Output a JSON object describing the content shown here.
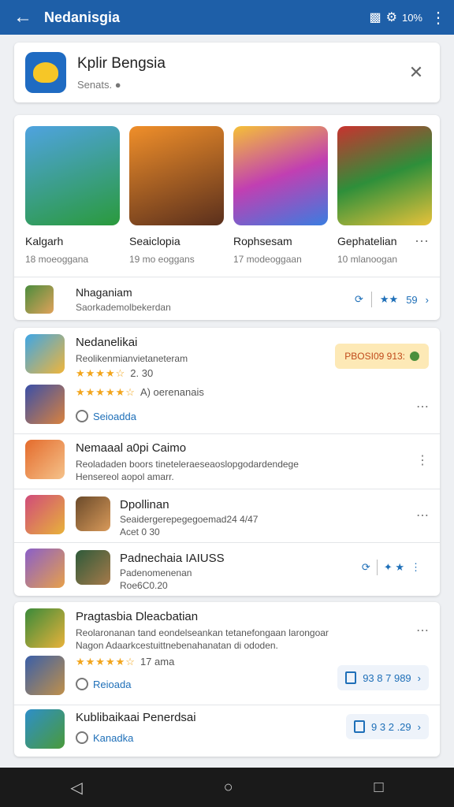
{
  "appbar": {
    "title": "Nedanisgia",
    "action_icons": [
      "image-icon",
      "settings-icon"
    ],
    "action_text": "10%",
    "more_icon": "more-vert-icon"
  },
  "header_card": {
    "app_name": "Kplir Bengsia",
    "subtitle": "Senats.",
    "close_icon": "close-icon"
  },
  "featured": {
    "tiles": [
      {
        "title": "Kalgarh",
        "meta": "18 moeoggana"
      },
      {
        "title": "Seaiclopia",
        "meta": "19 mo eoggans"
      },
      {
        "title": "Rophsesam",
        "meta": "17 modeoggaan"
      },
      {
        "title": "Gephatelian",
        "meta": "10 mlanoogan"
      }
    ],
    "promo": {
      "name": "Nhaganiam",
      "desc": "Saorkademolbekerdan",
      "rating": "59"
    }
  },
  "list1": {
    "items": [
      {
        "name": "Nedanelikai",
        "desc": "Reolikenmianvietaneteram",
        "rating_num": "2. 30",
        "badge": "PBOSI09 913:"
      },
      {
        "rating_label": "A) oerenanais",
        "link": "Seioadda"
      },
      {
        "name": "Nemaaal a0pi Caimo",
        "desc": "Reoladaden boors tineteleraeseaoslopgodardendege",
        "desc2": "Hensereol aopol amarr."
      },
      {
        "name": "Dpollinan",
        "desc": "Seaidergerepegegoemad24 4/47",
        "desc2": "Acet 0 30"
      },
      {
        "name": "Padnechaia IAIUSS",
        "desc": "Padenomenenan",
        "desc2": "Roe6C0.20"
      }
    ]
  },
  "list2": {
    "items": [
      {
        "name": "Pragtasbia Dleacbatian",
        "desc": "Reolaronanan tand eondelseankan tetanefongaan larongoar",
        "desc2": "Nagon Adaarkcestuittnebenahanatan di ododen.",
        "rating_num": "17 ama",
        "link": "Reioada",
        "pill": "93 8 7 989"
      },
      {
        "name": "Kublibaikaai Penerdsai",
        "link": "Kanadka",
        "pill": "9 3 2 .29"
      }
    ]
  },
  "navbar": {
    "icons": [
      "back-triangle-icon",
      "home-circle-icon",
      "recents-square-icon"
    ]
  }
}
